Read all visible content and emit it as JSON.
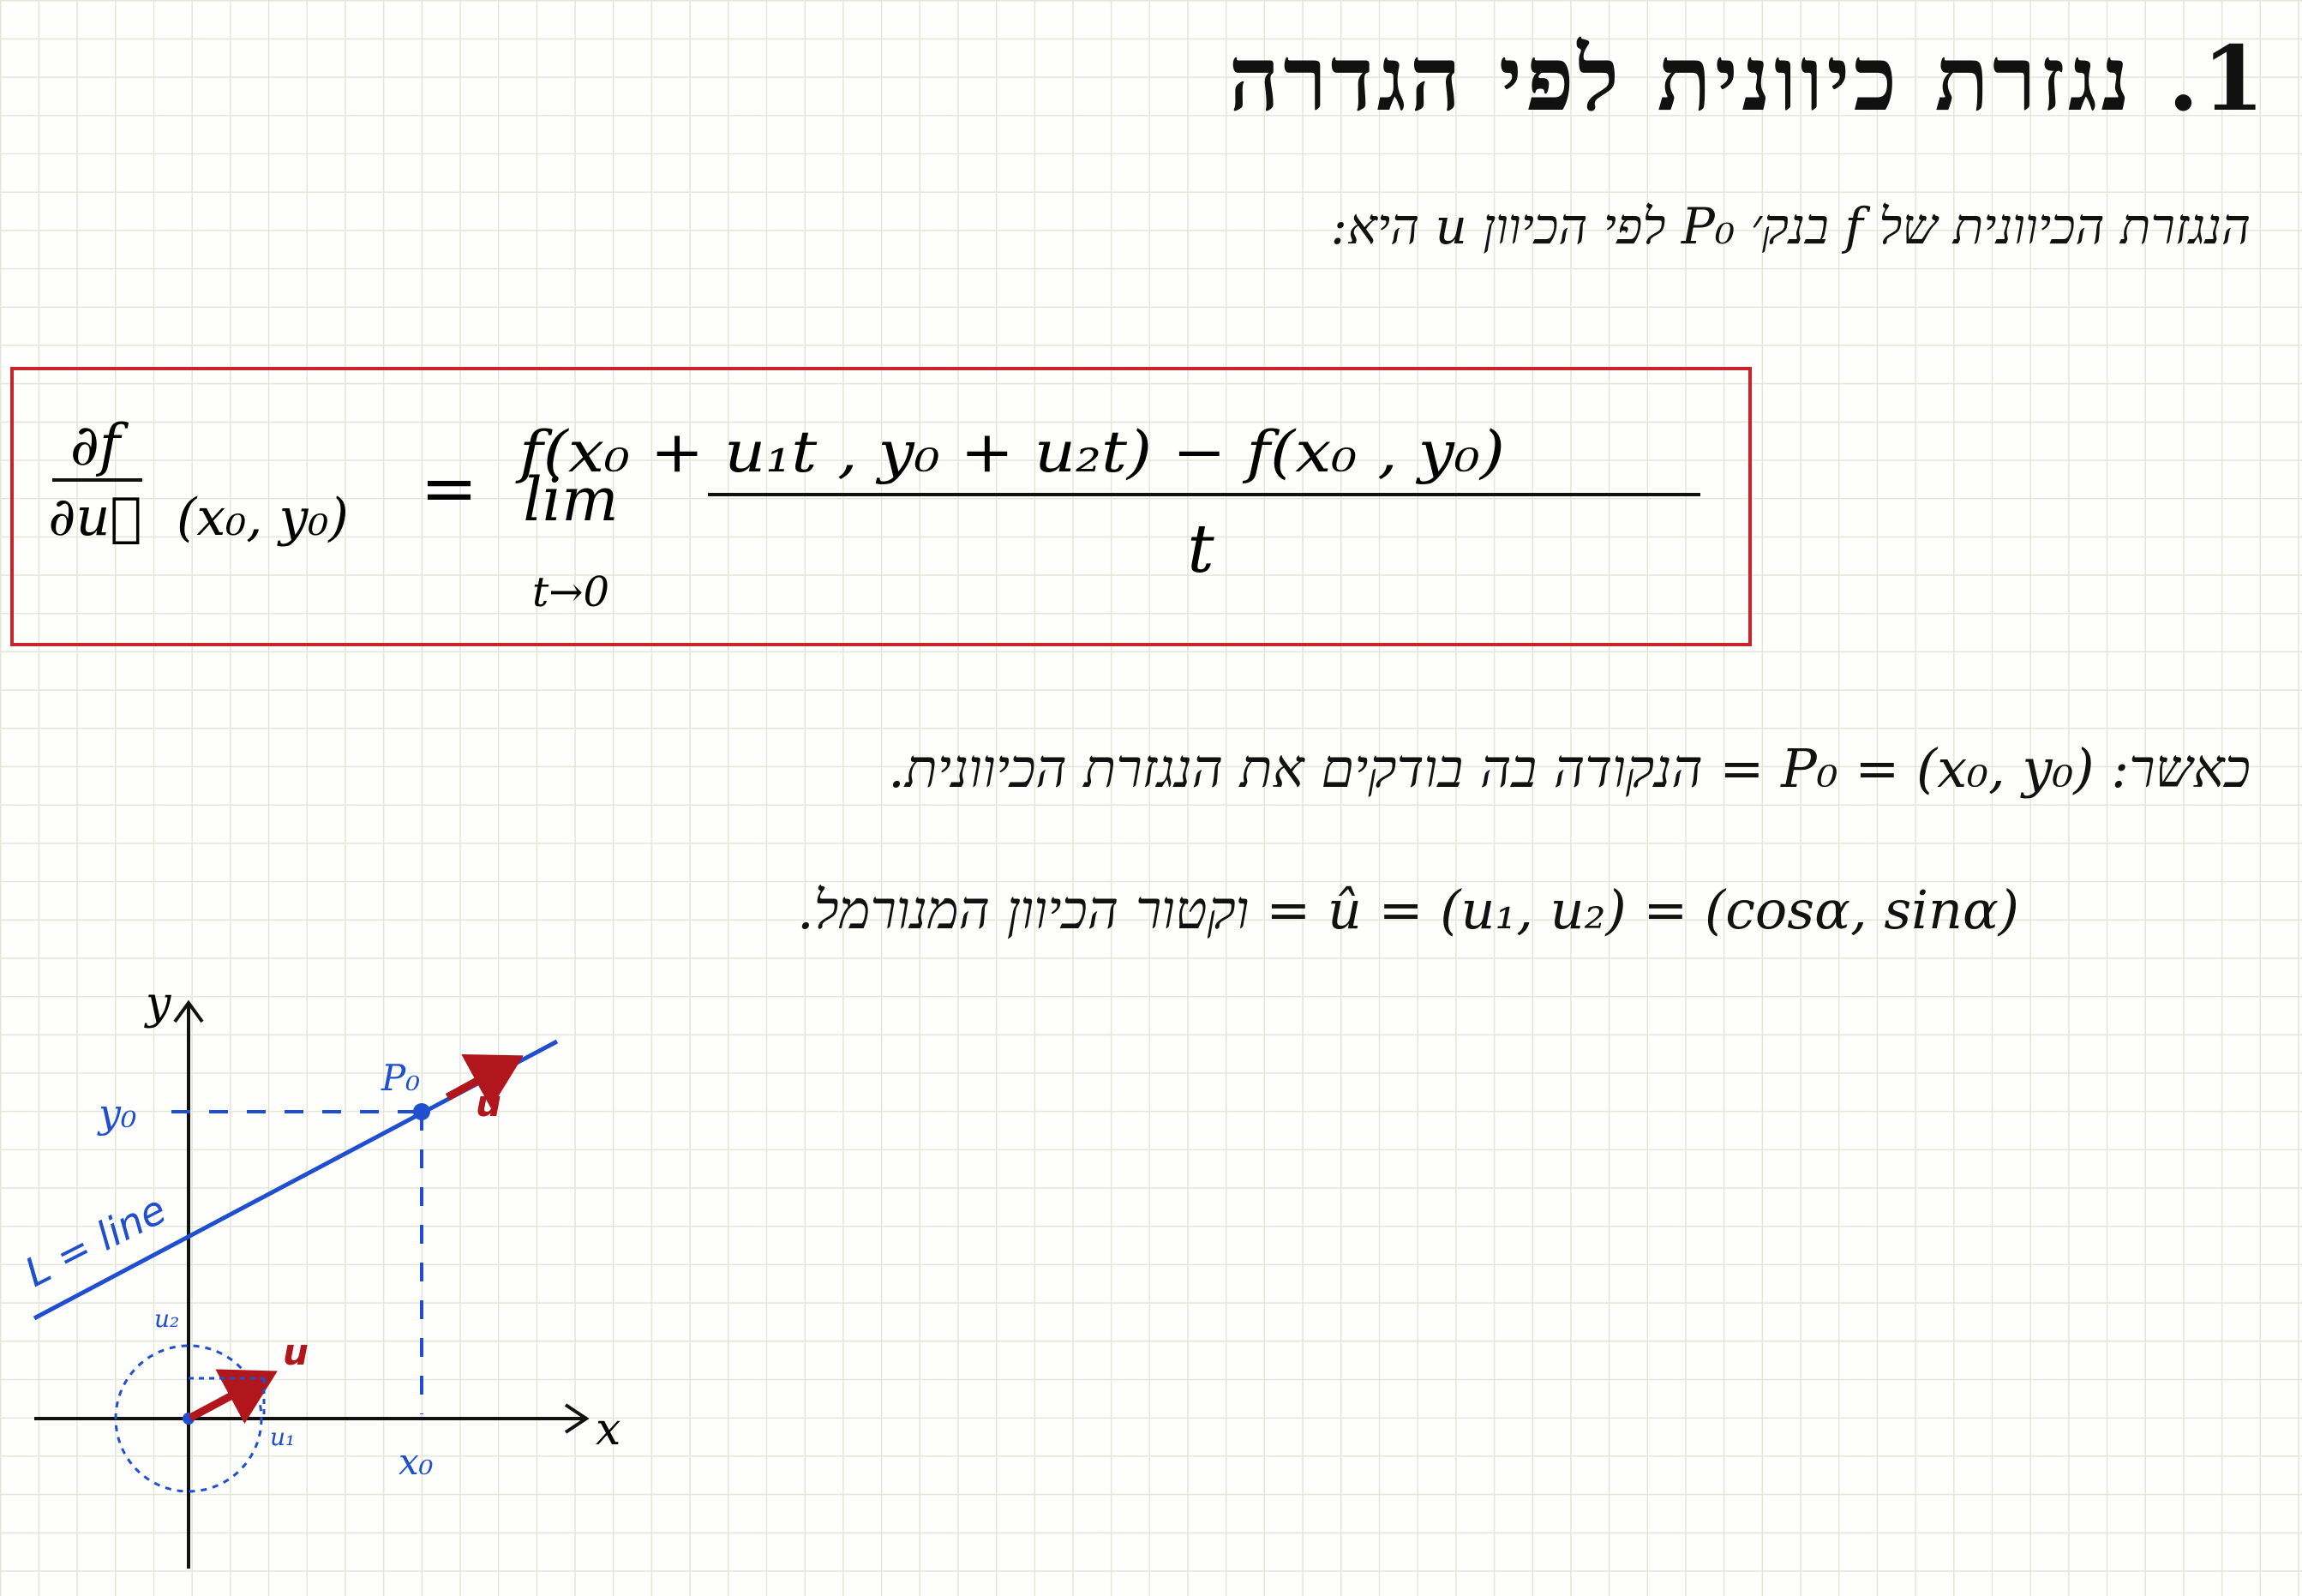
{
  "title": "1. נגזרת כיוונית לפי הגדרה",
  "intro": "הנגזרת הכיוונית של f בנק׳ P₀ לפי הכיוון u היא:",
  "formula": {
    "lhs_numerator": "∂f",
    "lhs_denominator": "∂u⃗",
    "lhs_point": "(x₀, y₀)",
    "equals": "=",
    "lim": "lim",
    "lim_sub": "t→0",
    "numerator": "f(x₀ + u₁t , y₀ + u₂t) − f(x₀ , y₀)",
    "denominator": "t"
  },
  "where_line": "כאשר: P₀ = (x₀, y₀) = הנקודה בה בודקים את הנגזרת הכיוונית.",
  "unit_line": "û = (u₁, u₂) = (cosα, sinα) = וקטור הכיוון המנורמל.",
  "diagram": {
    "y_axis_label": "y",
    "x_axis_label": "x",
    "y0_label": "y₀",
    "x0_label": "x₀",
    "p0_label": "P₀",
    "u_label_top": "u",
    "u_label_bottom": "u",
    "u1_label": "u₁",
    "u2_label": "u₂",
    "line_label": "L = line",
    "colors": {
      "blue": "#1f4fcf",
      "red": "#b0161c"
    }
  }
}
